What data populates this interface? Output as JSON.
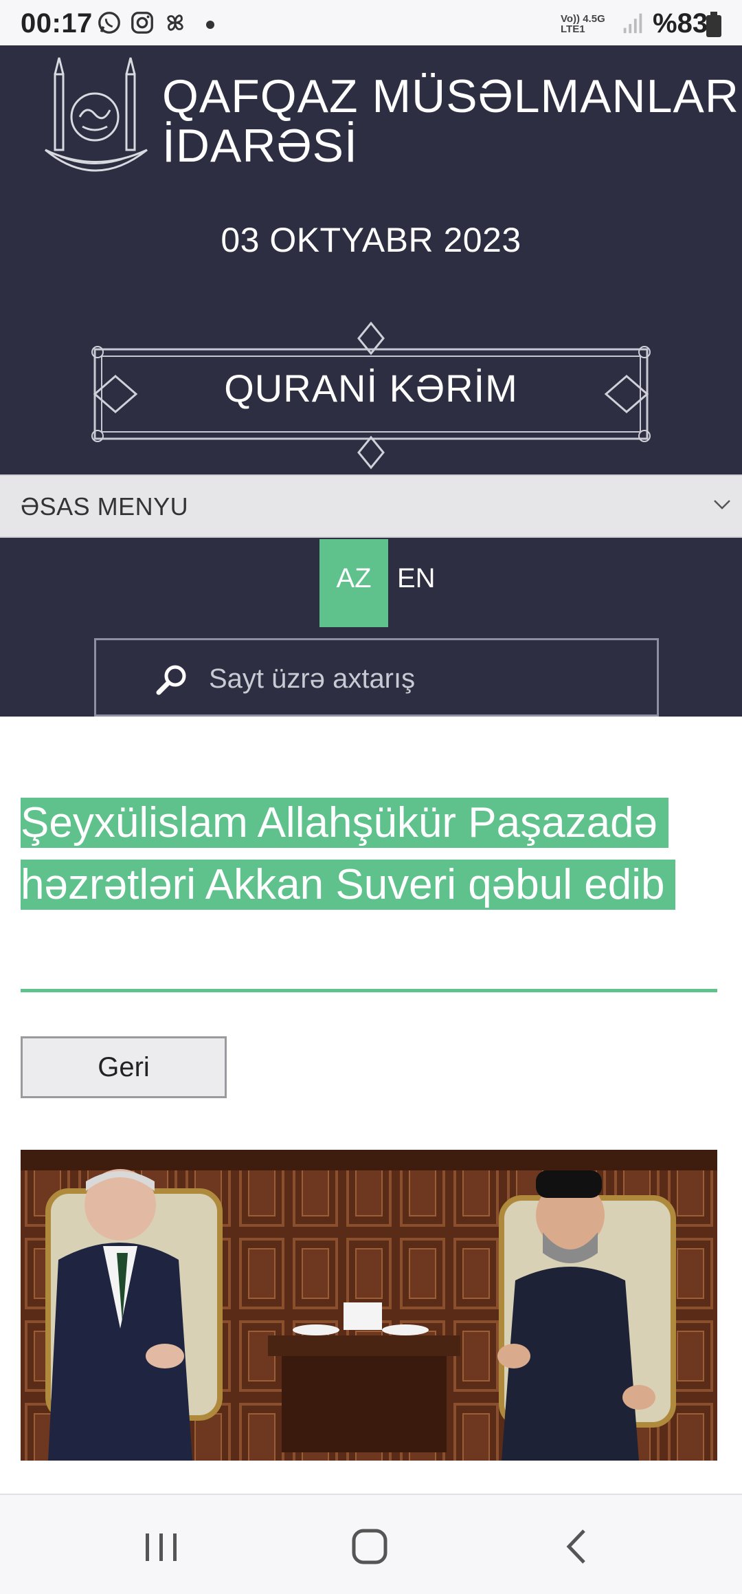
{
  "status_bar": {
    "time": "00:17",
    "network_label_top": "Vo)) 4.5G",
    "network_label_bottom": "LTE1",
    "battery": "%83",
    "icons": [
      "whatsapp-icon",
      "instagram-icon",
      "pinwheel-icon",
      "signal-icon",
      "battery-icon"
    ]
  },
  "header": {
    "site_name_line1": "QAFQAZ MÜSƏLMANLARI",
    "site_name_line2": "İDARƏSİ",
    "date": "03 OKTYABR 2023",
    "quran_link": "QURANİ KƏRİM"
  },
  "menu": {
    "label": "ƏSAS MENYU"
  },
  "languages": {
    "az": "AZ",
    "en": "EN",
    "active": "AZ"
  },
  "search": {
    "placeholder": "Sayt üzrə axtarış",
    "value": ""
  },
  "article": {
    "title": "Şeyxülislam Allahşükür Paşazadə həzrətləri Akkan Suveri qəbul edib",
    "back_label": "Geri"
  },
  "colors": {
    "header_bg": "#2d2e42",
    "accent_green": "#5fc18c",
    "menu_bg": "#e6e6e8"
  }
}
